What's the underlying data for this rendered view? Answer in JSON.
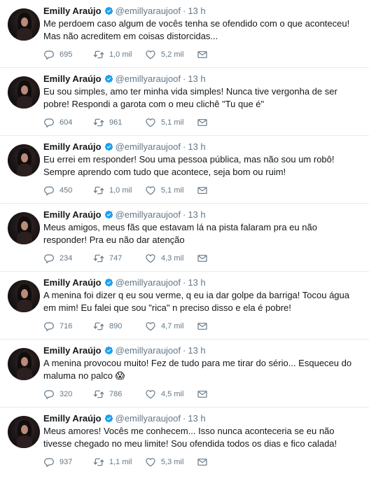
{
  "tweets": [
    {
      "name": "Emilly Araújo",
      "handle": "@emillyaraujoof",
      "separator": "·",
      "time": "13 h",
      "text_lines": [
        "Me perdoem caso algum de vocês tenha se ofendido com o que aconteceu!",
        "Mas não acreditem em coisas distorcidas..."
      ],
      "replies": "695",
      "retweets": "1,0 mil",
      "likes": "5,2 mil"
    },
    {
      "name": "Emilly Araújo",
      "handle": "@emillyaraujoof",
      "separator": "·",
      "time": "13 h",
      "text_lines": [
        "Eu sou simples, amo ter minha vida simples! Nunca tive vergonha de ser",
        "pobre! Respondi a garota com o meu clichê \"Tu que é\""
      ],
      "replies": "604",
      "retweets": "961",
      "likes": "5,1 mil"
    },
    {
      "name": "Emilly Araújo",
      "handle": "@emillyaraujoof",
      "separator": "·",
      "time": "13 h",
      "text_lines": [
        "Eu errei em responder! Sou uma pessoa pública, mas não sou um robô!",
        "Sempre aprendo com tudo que acontece, seja bom ou ruim!"
      ],
      "replies": "450",
      "retweets": "1,0 mil",
      "likes": "5,1 mil"
    },
    {
      "name": "Emilly Araújo",
      "handle": "@emillyaraujoof",
      "separator": "·",
      "time": "13 h",
      "text_lines": [
        "Meus amigos, meus fãs que estavam lá na pista falaram pra eu não",
        "responder! Pra eu não dar atenção"
      ],
      "replies": "234",
      "retweets": "747",
      "likes": "4,3 mil"
    },
    {
      "name": "Emilly Araújo",
      "handle": "@emillyaraujoof",
      "separator": "·",
      "time": "13 h",
      "text_lines": [
        "A menina foi dizer q eu sou verme, q eu ia dar golpe da barriga! Tocou água",
        "em mim! Eu falei que sou \"rica\" n preciso disso e ela é pobre!"
      ],
      "replies": "716",
      "retweets": "890",
      "likes": "4,7 mil"
    },
    {
      "name": "Emilly Araújo",
      "handle": "@emillyaraujoof",
      "separator": "·",
      "time": "13 h",
      "text_lines": [
        "A menina provocou muito! Fez de tudo para me tirar do sério... Esqueceu do",
        "maluma no palco 😱"
      ],
      "replies": "320",
      "retweets": "786",
      "likes": "4,5 mil"
    },
    {
      "name": "Emilly Araújo",
      "handle": "@emillyaraujoof",
      "separator": "·",
      "time": "13 h",
      "text_lines": [
        "Meus amores! Vocês me conhecem... Isso nunca aconteceria se eu não",
        "tivesse chegado no meu limite! Sou ofendida todos os dias e fico calada!"
      ],
      "replies": "937",
      "retweets": "1,1 mil",
      "likes": "5,3 mil"
    }
  ],
  "icons": {
    "verified": "verified-badge-icon",
    "reply": "reply-icon",
    "retweet": "retweet-icon",
    "like": "heart-icon",
    "dm": "direct-message-icon"
  },
  "colors": {
    "verified": "#1da1f2",
    "icon": "#657786",
    "text": "#14171a",
    "divider": "#e6ecf0"
  }
}
